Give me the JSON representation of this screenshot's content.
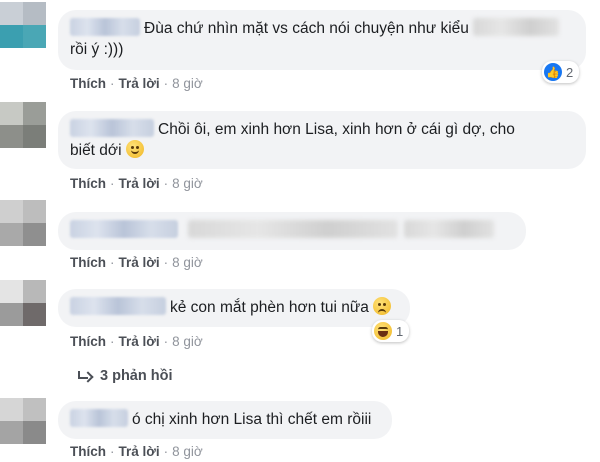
{
  "comments": [
    {
      "text": "Đùa chứ nhìn mặt vs cách nói chuyện như kiểu",
      "text2": "rồi ý :)))",
      "like": "Thích",
      "reply": "Trả lời",
      "time": "8 giờ",
      "reaction_count": "2",
      "reaction_type": "like"
    },
    {
      "text": "Chồi ôi, em xinh hơn Lisa, xinh hơn ở cái gì dợ, cho",
      "text2": "biết dới",
      "like": "Thích",
      "reply": "Trả lời",
      "time": "8 giờ"
    },
    {
      "like": "Thích",
      "reply": "Trả lời",
      "time": "8 giờ"
    },
    {
      "text": "kẻ con mắt phèn hơn tui nữa",
      "like": "Thích",
      "reply": "Trả lời",
      "time": "8 giờ",
      "reaction_count": "1",
      "reaction_type": "haha"
    },
    {
      "text": "ó chị xinh hơn Lisa thì chết em rồiii",
      "like": "Thích",
      "reply": "Trả lời",
      "time": "8 giờ"
    }
  ],
  "replies_label": "3 phản hồi",
  "colors": {
    "bubble": "#f2f3f5",
    "like_blue": "#1877f2",
    "meta_gray": "#616770"
  }
}
